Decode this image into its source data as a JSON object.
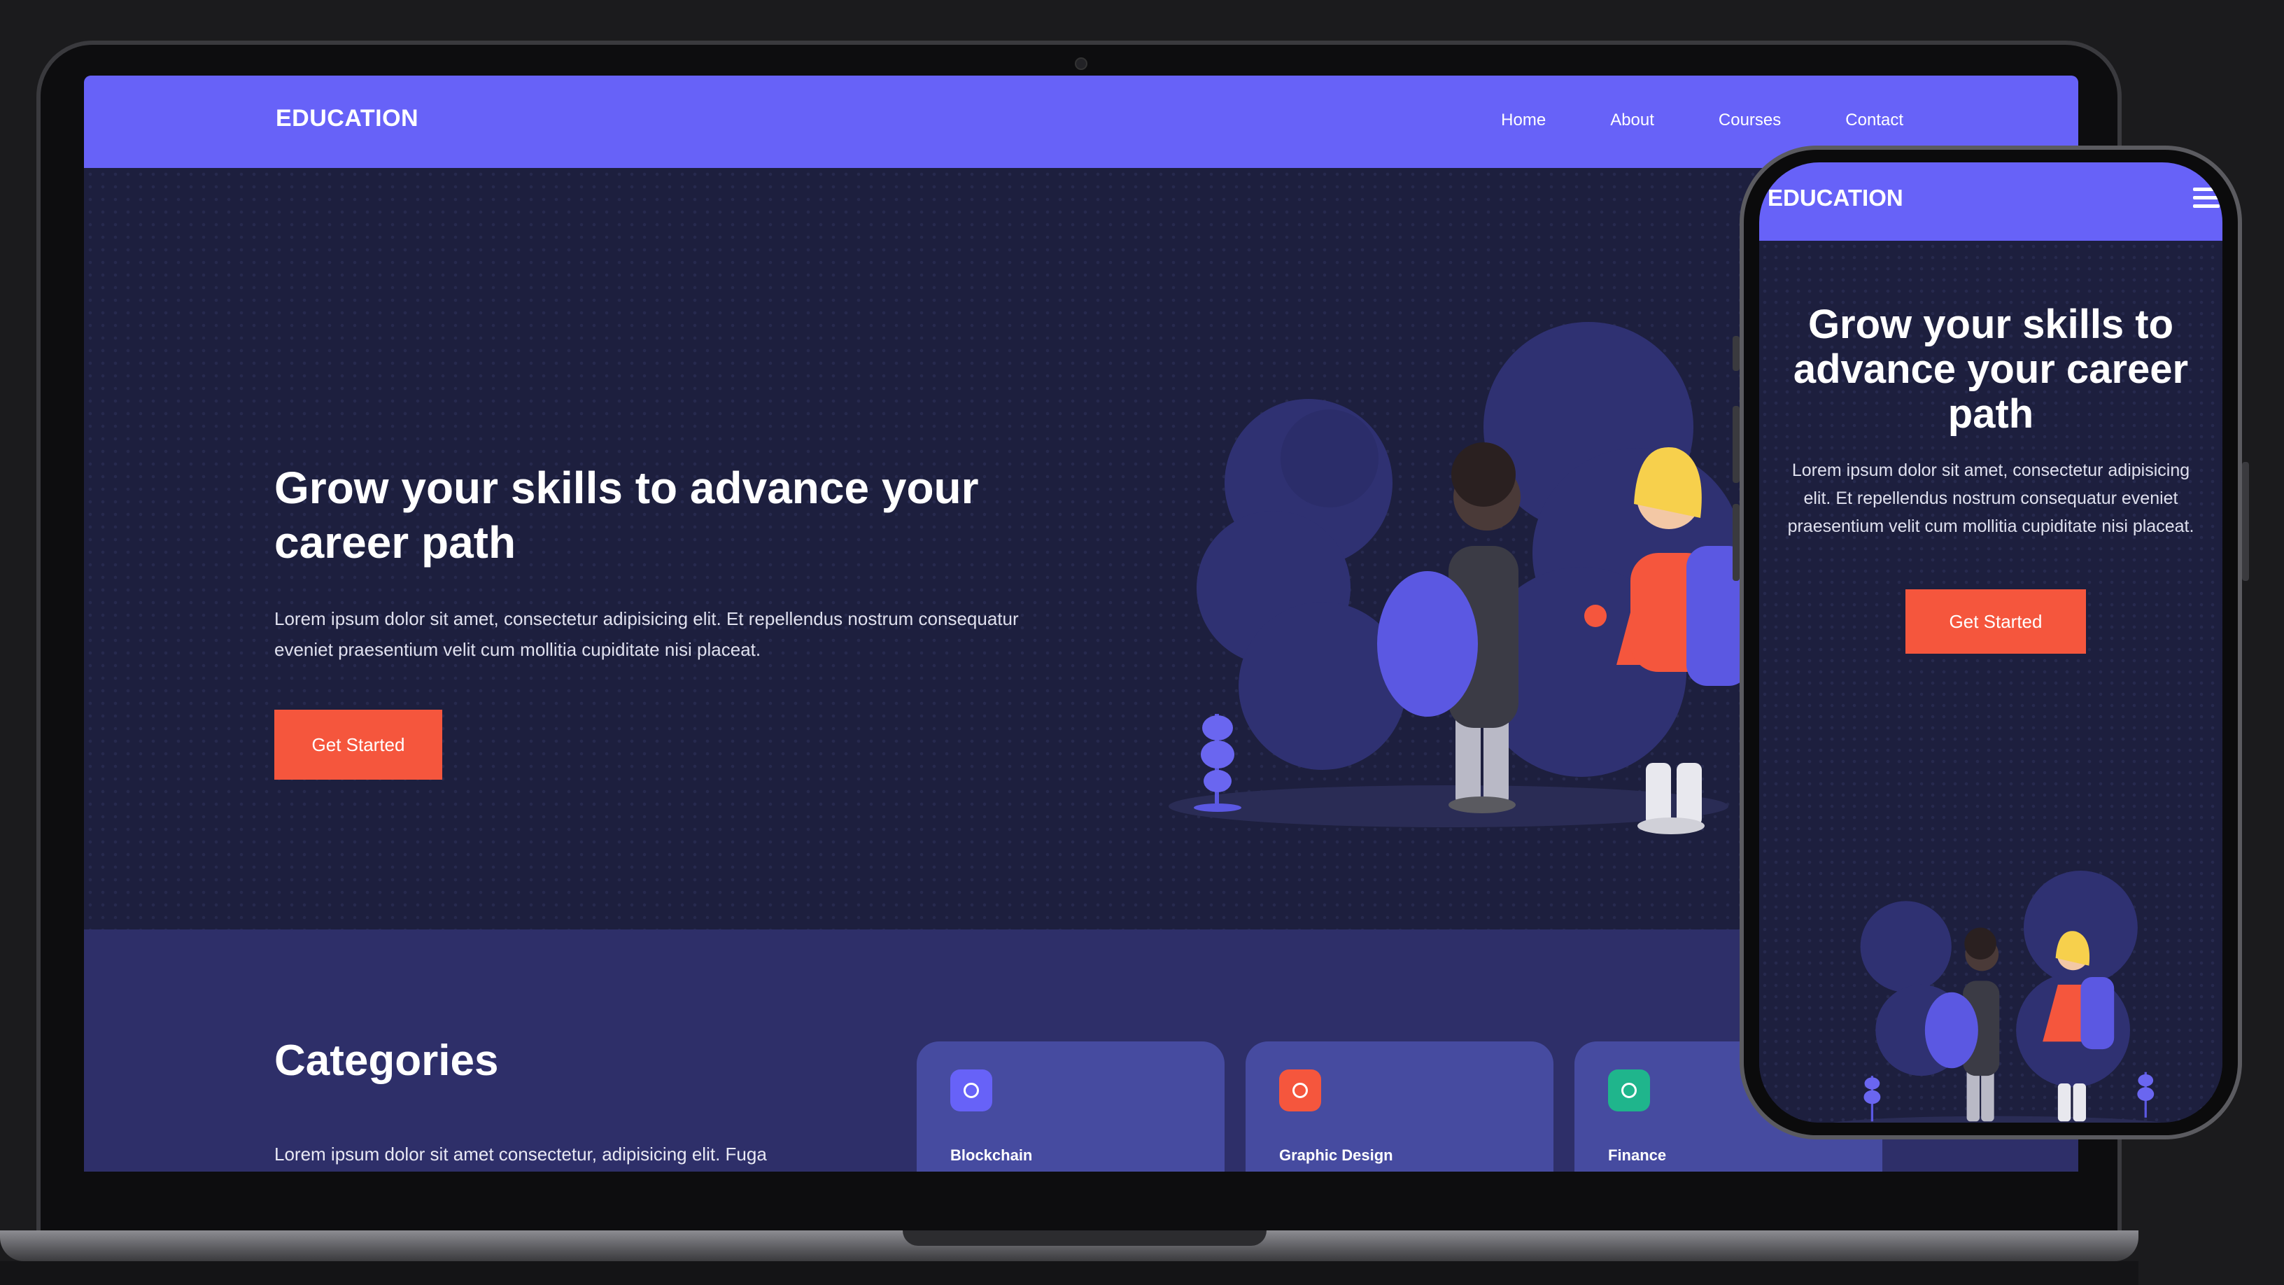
{
  "site": {
    "brand": "EDUCATION",
    "nav": [
      "Home",
      "About",
      "Courses",
      "Contact"
    ]
  },
  "hero": {
    "title": "Grow your skills to advance your career path",
    "text": "Lorem ipsum dolor sit amet, consectetur adipisicing elit. Et repellendus nostrum consequatur eveniet praesentium velit cum mollitia cupiditate nisi placeat.",
    "button": "Get Started"
  },
  "categories": {
    "title": "Categories",
    "text": "Lorem ipsum dolor sit amet consectetur, adipisicing elit. Fuga",
    "cards": [
      {
        "label": "Blockchain",
        "icon": "blockchain-icon",
        "color": "#6762f8"
      },
      {
        "label": "Graphic Design",
        "icon": "palette-icon",
        "color": "#f5563d"
      },
      {
        "label": "Finance",
        "icon": "dollar-icon",
        "color": "#1fb58c"
      }
    ]
  },
  "mobile": {
    "brand": "EDUCATION",
    "menu_icon": "hamburger-menu-icon",
    "title": "Grow your skills to advance your career path",
    "text": "Lorem ipsum dolor sit amet, consectetur adipisicing elit. Et repellendus nostrum consequatur eveniet praesentium velit cum mollitia cupiditate nisi placeat.",
    "button": "Get Started"
  },
  "colors": {
    "nav": "#6762f8",
    "hero_bg": "#1d1f3e",
    "section_bg": "#2e2f69",
    "accent": "#f5563d"
  }
}
